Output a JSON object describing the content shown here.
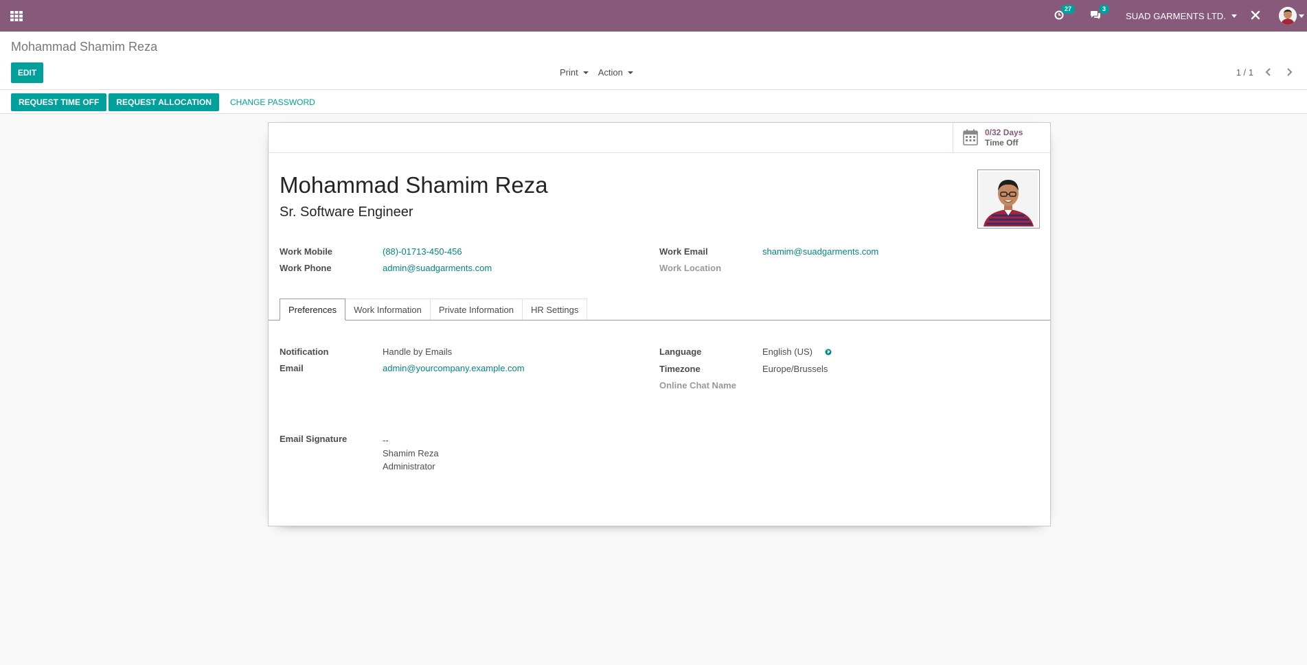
{
  "navbar": {
    "activity_count": "27",
    "message_count": "3",
    "company": "SUAD GARMENTS LTD."
  },
  "control_panel": {
    "breadcrumb": "Mohammad Shamim Reza",
    "edit_label": "EDIT",
    "print_label": "Print",
    "action_label": "Action",
    "pager": "1 / 1"
  },
  "statusbar": {
    "request_time_off": "REQUEST TIME OFF",
    "request_allocation": "REQUEST ALLOCATION",
    "change_password": "CHANGE PASSWORD"
  },
  "stat_button": {
    "value": "0/32 Days",
    "label": "Time Off"
  },
  "employee": {
    "name": "Mohammad Shamim Reza",
    "job_title": "Sr. Software Engineer",
    "work_mobile_label": "Work Mobile",
    "work_mobile": "(88)-01713-450-456",
    "work_phone_label": "Work Phone",
    "work_phone": "admin@suadgarments.com",
    "work_email_label": "Work Email",
    "work_email": "shamim@suadgarments.com",
    "work_location_label": "Work Location"
  },
  "tabs": [
    "Preferences",
    "Work Information",
    "Private Information",
    "HR Settings"
  ],
  "preferences": {
    "notification_label": "Notification",
    "notification": "Handle by Emails",
    "email_label": "Email",
    "email": "admin@yourcompany.example.com",
    "language_label": "Language",
    "language": "English (US)",
    "timezone_label": "Timezone",
    "timezone": "Europe/Brussels",
    "online_chat_label": "Online Chat Name",
    "signature_label": "Email Signature",
    "signature_lines": [
      "--",
      "Shamim Reza",
      "Administrator"
    ]
  },
  "colors": {
    "navbar": "#875a7b",
    "primary": "#00a09d",
    "link": "#008784"
  }
}
